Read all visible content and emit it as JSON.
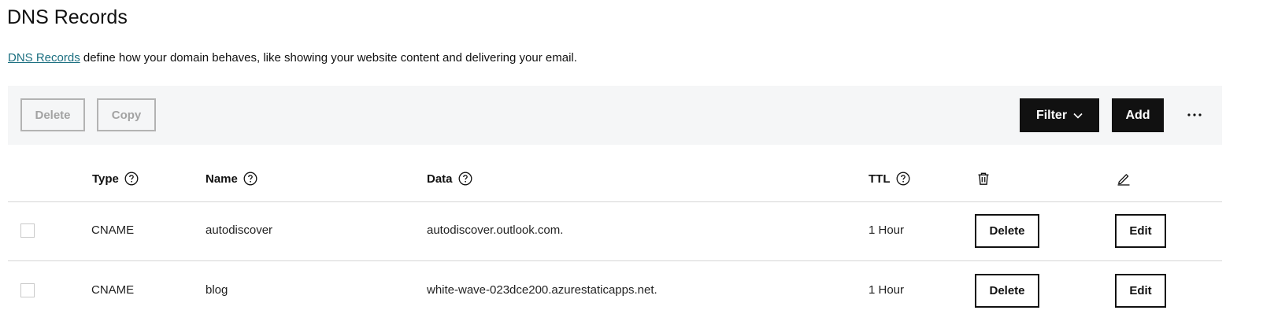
{
  "page": {
    "title": "DNS Records",
    "intro_link": "DNS Records",
    "intro_text": " define how your domain behaves, like showing your website content and delivering your email."
  },
  "toolbar": {
    "delete_label": "Delete",
    "copy_label": "Copy",
    "filter_label": "Filter",
    "add_label": "Add",
    "more_icon": "ellipsis-icon"
  },
  "table": {
    "columns": {
      "type": "Type",
      "name": "Name",
      "data": "Data",
      "ttl": "TTL",
      "delete_icon": "trash-icon",
      "edit_icon": "pencil-icon"
    },
    "rows": [
      {
        "type": "CNAME",
        "name": "autodiscover",
        "data": "autodiscover.outlook.com.",
        "ttl": "1 Hour",
        "delete_label": "Delete",
        "edit_label": "Edit"
      },
      {
        "type": "CNAME",
        "name": "blog",
        "data": "white-wave-023dce200.azurestaticapps.net.",
        "ttl": "1 Hour",
        "delete_label": "Delete",
        "edit_label": "Edit"
      }
    ]
  },
  "colors": {
    "link": "#1b6f80",
    "toolbar_bg": "#f5f6f7",
    "primary_button": "#111111",
    "disabled_border": "#b3b3b3"
  }
}
